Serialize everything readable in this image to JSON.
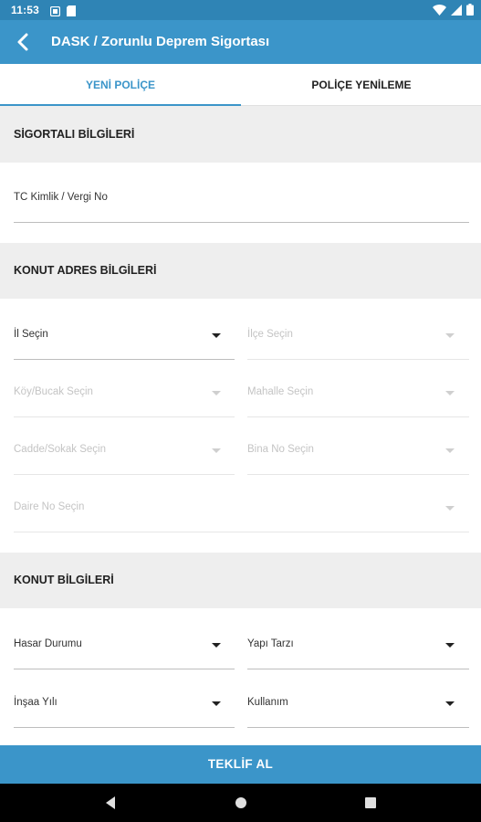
{
  "status_bar": {
    "time": "11:53",
    "icons": [
      "notification-icon",
      "sim-icon",
      "wifi-icon",
      "signal-icon",
      "battery-icon"
    ]
  },
  "app_bar": {
    "title": "DASK / Zorunlu Deprem Sigortası",
    "back_icon": "chevron-left-icon"
  },
  "tabs": [
    {
      "label": "YENİ POLİÇE",
      "active": true
    },
    {
      "label": "POLİÇE YENİLEME",
      "active": false
    }
  ],
  "sections": {
    "insured": {
      "title": "SİGORTALI BİLGİLERİ",
      "tc_field": "TC Kimlik / Vergi No"
    },
    "address": {
      "title": "KONUT ADRES BİLGİLERİ",
      "il": "İl Seçin",
      "ilce": "İlçe Seçin",
      "koy": "Köy/Bucak Seçin",
      "mahalle": "Mahalle Seçin",
      "cadde": "Cadde/Sokak Seçin",
      "bina": "Bina No Seçin",
      "daire": "Daire No Seçin"
    },
    "dwelling": {
      "title": "KONUT BİLGİLERİ",
      "hasar": "Hasar Durumu",
      "yapi": "Yapı Tarzı",
      "insaa": "İnşaa Yılı",
      "kullanim": "Kullanım"
    }
  },
  "cta": {
    "label": "TEKLİF AL"
  },
  "colors": {
    "primary": "#3b95c9",
    "status_bar": "#2f84b5",
    "section_bg": "#eeeeee",
    "disabled_text": "#c4c4c4"
  }
}
